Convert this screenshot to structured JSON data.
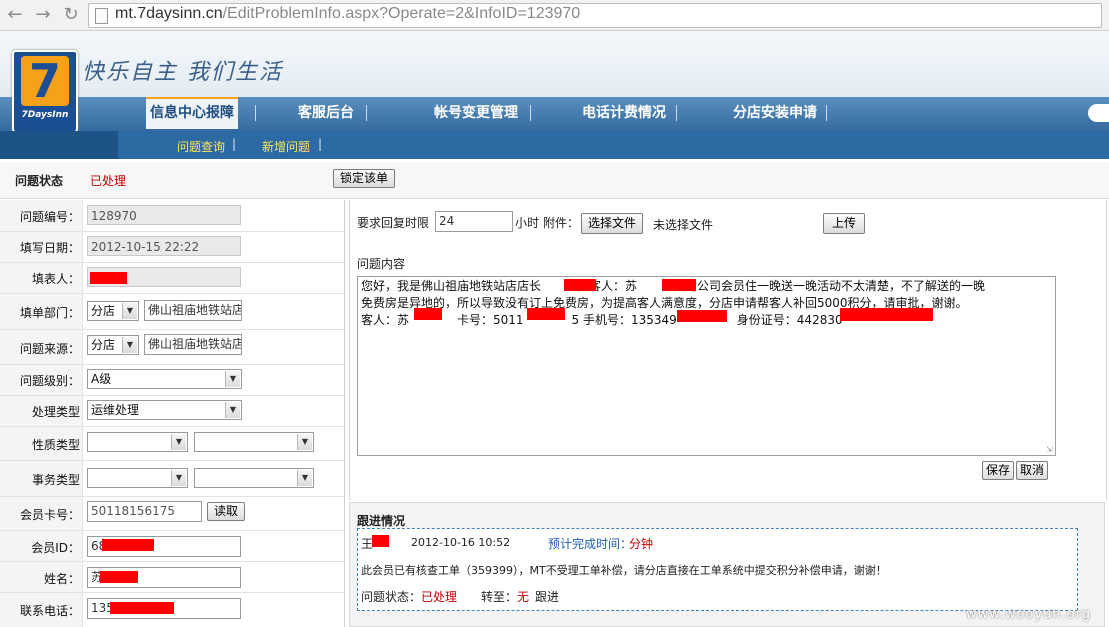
{
  "browser": {
    "url_domain": "mt.7daysinn.cn",
    "url_path": "/EditProblemInfo.aspx?Operate=2&InfoID=123970"
  },
  "header": {
    "logo_number": "7",
    "logo_brand": "7DaysInn",
    "slogan": "快乐自主 我们生活",
    "nav": [
      "信息中心报障",
      "客服后台",
      "帐号变更管理",
      "电话计费情况",
      "分店安装申请"
    ],
    "active_nav": "信息中心报障",
    "subnav": [
      "问题查询",
      "新增问题"
    ]
  },
  "status_row": {
    "label": "问题状态",
    "value": "已处理",
    "lock_button": "锁定该单"
  },
  "form": {
    "problem_no": {
      "label": "问题编号：",
      "value": "128970"
    },
    "fill_date": {
      "label": "填写日期：",
      "value": "2012-10-15 22:22"
    },
    "filler": {
      "label": "填表人："
    },
    "department": {
      "label": "填单部门：",
      "type": "分店",
      "name": "佛山祖庙地铁站店"
    },
    "source": {
      "label": "问题来源：",
      "type": "分店",
      "name": "佛山祖庙地铁站店"
    },
    "level": {
      "label": "问题级别：",
      "value": "A级"
    },
    "handle_type": {
      "label": "处理类型",
      "value": "运维处理"
    },
    "nature_type": {
      "label": "性质类型"
    },
    "affair_type": {
      "label": "事务类型"
    },
    "member_card": {
      "label": "会员卡号：",
      "value": "50118156175",
      "read_button": "读取"
    },
    "member_id": {
      "label": "会员ID：",
      "value": "68"
    },
    "name": {
      "label": "姓名：",
      "value": "苏"
    },
    "phone": {
      "label": "联系电话：",
      "value": "135"
    }
  },
  "reply": {
    "deadline_label": "要求回复时限",
    "deadline_value": "24",
    "hours_label": "小时",
    "attach_label": "附件：",
    "choose_file": "选择文件",
    "no_file": "未选择文件",
    "upload": "上传",
    "content_label": "问题内容",
    "content_line1": "您好，我是佛山祖庙地铁站店店长　　　，客人：苏　　　因对公司会员住一晚送一晚活动不太清楚，不了解送的一晚",
    "content_line2": "免费房是异地的，所以导致没有订上免费房，为提高客人满意度，分店申请帮客人补回5000积分，请审批，谢谢。",
    "content_line3": "客人：苏　　　　卡号：5011　　　　5 手机号：135349　　　　　身份证号：442830　　　　　　　　　　",
    "save": "保存",
    "cancel": "取消"
  },
  "follow": {
    "title": "跟进情况",
    "person": "王",
    "datetime": "2012-10-16 10:52",
    "eta_label": "预计完成时间：",
    "eta_value": "分钟",
    "message": "此会员已有核查工单（359399），MT不受理工单补偿，请分店直接在工单系统中提交积分补偿申请，谢谢！",
    "status_label": "问题状态：",
    "status_value": "已处理",
    "transfer_label": "转至：",
    "transfer_value": "无",
    "follow_text": "跟进"
  },
  "watermark": "www.wooyun.org"
}
